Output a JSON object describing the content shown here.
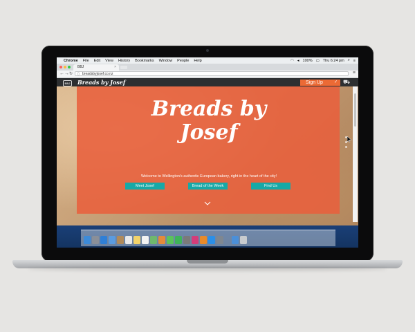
{
  "menubar": {
    "apple": "",
    "items": [
      "Chrome",
      "File",
      "Edit",
      "View",
      "History",
      "Bookmarks",
      "Window",
      "People",
      "Help"
    ],
    "battery": "100%",
    "clock": "Thu 6:24 pm"
  },
  "browser": {
    "tab_title": "BBJ",
    "url": "breadsbyjosef.co.nz"
  },
  "site": {
    "logo_badge": "BBJ",
    "logo_text": "Breads by Josef",
    "signup_label": "Sign Up",
    "hero_title": "Breads by Josef",
    "tagline": "Welcome to Wellington's authentic European bakery, right in the heart of the city!",
    "buttons": [
      "Meet Josef",
      "Bread of the Week",
      "Find Us"
    ],
    "colors": {
      "overlay": "#e8603c",
      "accent": "#17a9a7",
      "signup": "#ec6a35",
      "nav": "#2d2f31"
    }
  },
  "dock_icons": [
    "finder-icon",
    "launchpad-icon",
    "safari-icon",
    "mail-icon",
    "contacts-icon",
    "calendar-icon",
    "notes-icon",
    "reminders-icon",
    "maps-icon",
    "photos-icon",
    "messages-icon",
    "facetime-icon",
    "photo-booth-icon",
    "itunes-icon",
    "ibooks-icon",
    "app-store-icon",
    "system-preferences-icon",
    "chrome-icon",
    "trash-icon"
  ]
}
